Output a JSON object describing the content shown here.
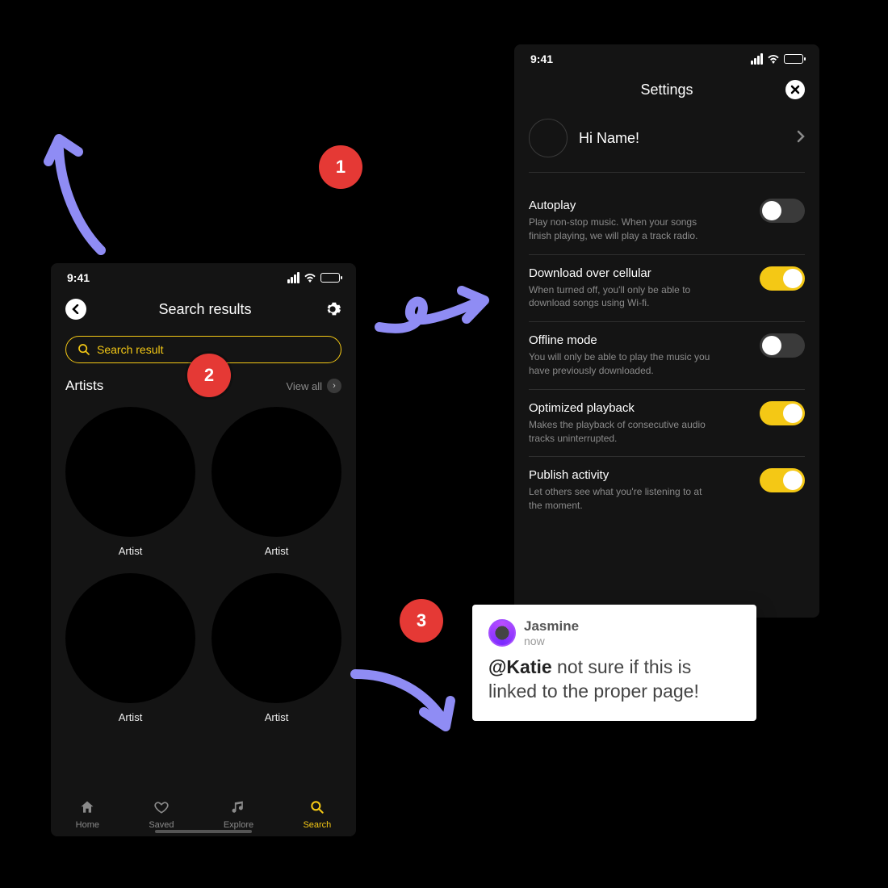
{
  "statusbar": {
    "time": "9:41"
  },
  "search_screen": {
    "title": "Search results",
    "search_value": "Search result",
    "section_label": "Artists",
    "view_all": "View all",
    "artists": [
      {
        "name": "Artist"
      },
      {
        "name": "Artist"
      },
      {
        "name": "Artist"
      },
      {
        "name": "Artist"
      }
    ],
    "nav": {
      "home": "Home",
      "saved": "Saved",
      "explore": "Explore",
      "search": "Search"
    }
  },
  "settings_screen": {
    "title": "Settings",
    "greeting": "Hi Name!",
    "items": [
      {
        "title": "Autoplay",
        "desc": "Play non-stop music. When your songs finish playing, we will play a track radio.",
        "on": false
      },
      {
        "title": "Download over cellular",
        "desc": "When turned off, you'll only be able to download songs using Wi-fi.",
        "on": true
      },
      {
        "title": "Offline mode",
        "desc": "You will only be able to play the music you have previously downloaded.",
        "on": false
      },
      {
        "title": "Optimized playback",
        "desc": "Makes the playback of consecutive audio tracks uninterrupted.",
        "on": true
      },
      {
        "title": "Publish activity",
        "desc": "Let others see what you're listening to at the moment.",
        "on": true
      }
    ]
  },
  "annotations": {
    "badge1": "1",
    "badge2": "2",
    "badge3": "3"
  },
  "comment": {
    "author": "Jasmine",
    "time": "now",
    "mention": "@Katie",
    "rest": " not sure if this is linked to the proper page!"
  },
  "colors": {
    "accent": "#f4c815",
    "annotation_red": "#e53935",
    "arrow": "#8f8cf4"
  }
}
